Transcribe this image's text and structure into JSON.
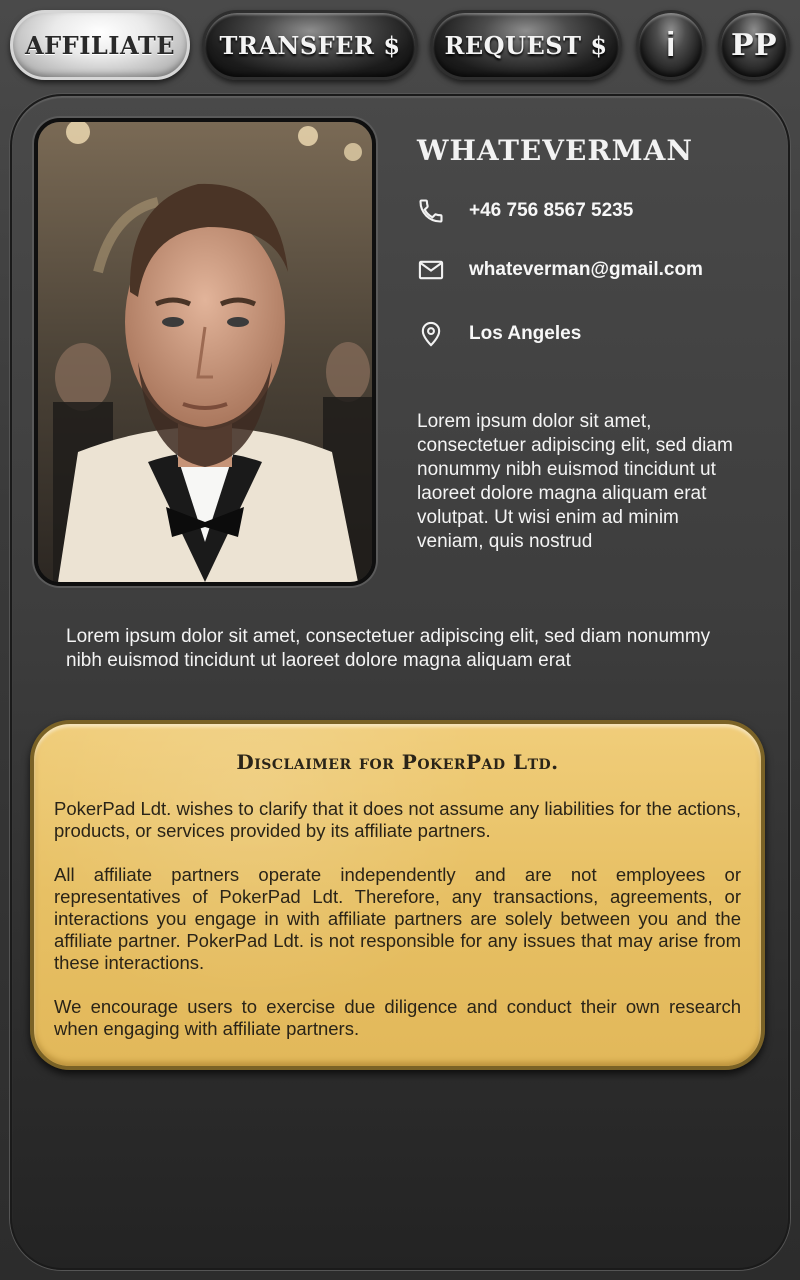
{
  "nav": {
    "affiliate": "AFFILIATE",
    "transfer": "TRANSFER $",
    "request": "REQUEST $",
    "info": "i",
    "logo": "PP"
  },
  "profile": {
    "name": "WHATEVERMAN",
    "phone": "+46 756 8567 5235",
    "email": "whateverman@gmail.com",
    "location": "Los Angeles",
    "bio": "Lorem ipsum dolor sit amet, consectetuer adipiscing elit, sed diam nonummy nibh euismod tincidunt ut laoreet dolore magna aliquam erat volutpat. Ut wisi enim ad minim veniam, quis nostrud",
    "tagline": "Lorem ipsum dolor sit amet, consectetuer adipiscing elit, sed diam nonummy nibh euismod tincidunt ut laoreet dolore magna aliquam erat"
  },
  "icons": {
    "phone": "phone-icon",
    "email": "mail-icon",
    "location": "location-pin-icon"
  },
  "disclaimer": {
    "title": "Disclaimer for PokerPad Ltd.",
    "paragraphs": [
      "PokerPad Ldt. wishes to clarify that it does not assume any liabilities for the actions, products, or services provided by its affiliate partners.",
      "All affiliate partners operate independently and are not employees or representatives of PokerPad Ldt. Therefore, any transactions, agreements, or interactions you engage in with affiliate partners are solely between you and the affiliate partner. PokerPad Ldt. is not responsible for any issues that may arise from these interactions.",
      "We encourage users to exercise due diligence and conduct their own research when engaging with affiliate partners."
    ]
  },
  "colors": {
    "background": "#3a3a3a",
    "disclaimer_gold": "#e7c064",
    "text_light": "#f4f4f4",
    "text_dark": "#2a2418"
  }
}
